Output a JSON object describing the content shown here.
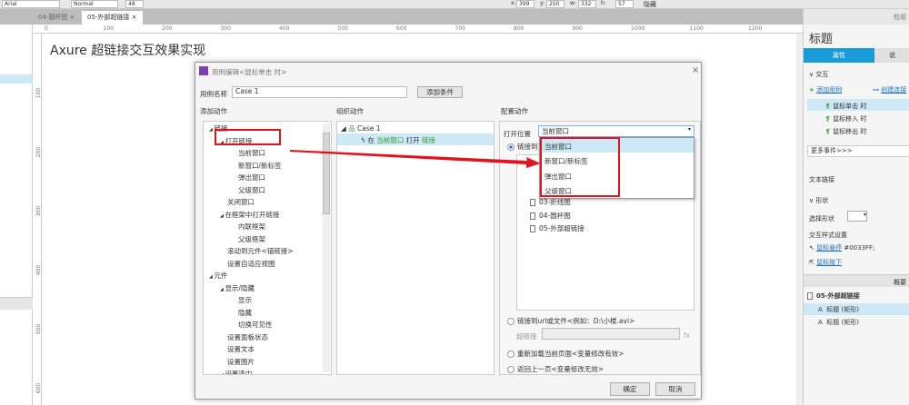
{
  "toolbar": {
    "font": "Arial",
    "style": "Normal",
    "size": "48",
    "x_label": "x:",
    "x": "399",
    "y_label": "y:",
    "y": "250",
    "w_label": "w:",
    "w": "332",
    "h_label": "h:",
    "h": "57",
    "hidden_label": "隐藏"
  },
  "tabs": [
    {
      "label": "04-圆杯图"
    },
    {
      "label": "05-外部超链接"
    }
  ],
  "ruler": {
    "top": [
      "0",
      "100",
      "200",
      "300",
      "400",
      "500",
      "600",
      "700",
      "800",
      "900",
      "1000",
      "1100",
      "1200"
    ],
    "left": [
      "100",
      "200",
      "300",
      "400",
      "500",
      "600"
    ]
  },
  "canvas": {
    "title": "Axure 超链接交互效果实现"
  },
  "dialog": {
    "title": "用例编辑<鼠标单击 时>",
    "case_name_label": "用例名称",
    "case_name": "Case 1",
    "add_condition": "添加条件",
    "add_action_label": "添加动作",
    "organize_label": "组织动作",
    "configure_label": "配置动作",
    "actions": [
      {
        "label": "链接",
        "level": 0,
        "expand": true
      },
      {
        "label": "打开链接",
        "level": 1,
        "expand": true
      },
      {
        "label": "当前窗口",
        "level": 2
      },
      {
        "label": "新窗口/新标签",
        "level": 2
      },
      {
        "label": "弹出窗口",
        "level": 2
      },
      {
        "label": "父级窗口",
        "level": 2
      },
      {
        "label": "关闭窗口",
        "level": 1
      },
      {
        "label": "在框架中打开链接",
        "level": 1,
        "expand": true
      },
      {
        "label": "内联框架",
        "level": 2
      },
      {
        "label": "父级框架",
        "level": 2
      },
      {
        "label": "滚动到元件<锚链接>",
        "level": 1
      },
      {
        "label": "设置自适应视图",
        "level": 1
      },
      {
        "label": "元件",
        "level": 0,
        "expand": true
      },
      {
        "label": "显示/隐藏",
        "level": 1,
        "expand": true
      },
      {
        "label": "显示",
        "level": 2
      },
      {
        "label": "隐藏",
        "level": 2
      },
      {
        "label": "切换可见性",
        "level": 2
      },
      {
        "label": "设置面板状态",
        "level": 1
      },
      {
        "label": "设置文本",
        "level": 1
      },
      {
        "label": "设置图片",
        "level": 1
      },
      {
        "label": "设置选中",
        "level": 1,
        "expand": true
      }
    ],
    "organize": {
      "case": "Case 1",
      "action_prefix": "在",
      "action_target": "当前窗口",
      "action_verb": "打开",
      "action_obj": "链接"
    },
    "open_in_label": "打开位置",
    "open_in_value": "当前窗口",
    "open_in_options": [
      "当前窗口",
      "新窗口/新标签",
      "弹出窗口",
      "父级窗口"
    ],
    "link_page_label": "链接到当前项目中的页面",
    "pages": [
      "03-折线图",
      "04-圆杯图",
      "05-外部超链接"
    ],
    "url_label": "链接到url或文件<例如：D:\\小楼.avi>",
    "hyperlink_label": "超链接",
    "fx": "fx",
    "reload_label": "重新加载当前页面<变量修改有效>",
    "back_label": "返回上一页<变量修改无效>",
    "ok": "确定",
    "cancel": "取消"
  },
  "right": {
    "search_label": "检视",
    "title": "标题",
    "tab_props": "属性",
    "tab_notes": "说",
    "interaction": "交互",
    "add_case": "添加用例",
    "create_link": "创建连接",
    "events": [
      "鼠标单击 时",
      "鼠标移入 时",
      "鼠标移出 时"
    ],
    "more_events": "更多事件>>>",
    "text_link": "文本链接",
    "shape": "形状",
    "select_shape": "选择形状",
    "interaction_style": "交互样式设置",
    "hover": "鼠标悬停",
    "hover_value": "#0033FF;",
    "mousedown": "鼠标按下",
    "outline_label": "概要",
    "outline_page": "05-外部超链接",
    "outline_items": [
      "标题 (矩形)",
      "标题 (矩形)"
    ]
  },
  "colors": {
    "accent": "#1a9ad6",
    "highlight": "#e0141e",
    "selected": "#cde8f6"
  }
}
